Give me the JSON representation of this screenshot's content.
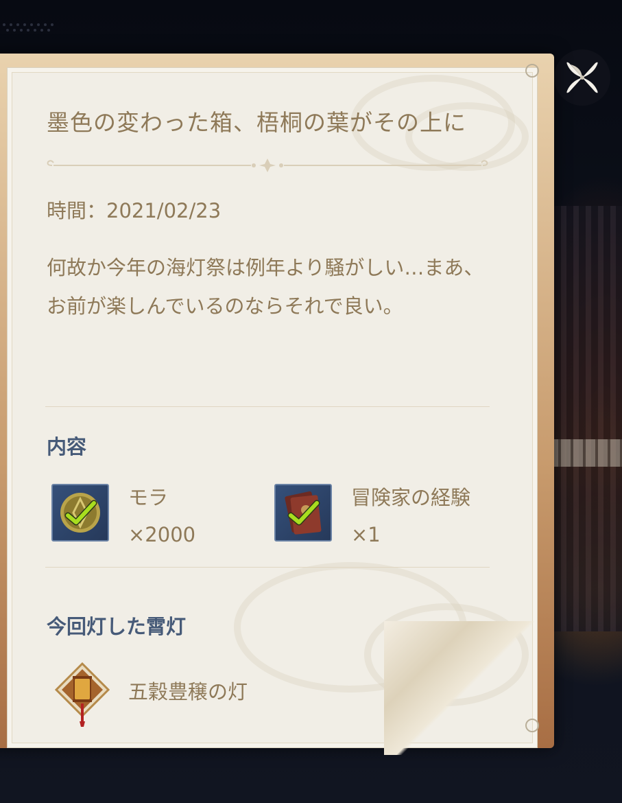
{
  "letter": {
    "title": "墨色の変わった箱、梧桐の葉がその上に",
    "time": "時間：2021/02/23",
    "message": "何故か今年の海灯祭は例年より騒がしい…まあ、お前が楽しんでいるのならそれで良い。"
  },
  "contents": {
    "heading": "内容",
    "items": [
      {
        "name": "モラ",
        "quantity": "×2000",
        "icon": "mora-coin-icon",
        "claimed": true
      },
      {
        "name": "冒険家の経験",
        "quantity": "×1",
        "icon": "adventurers-experience-book-icon",
        "claimed": true
      }
    ]
  },
  "lantern": {
    "heading": "今回灯した霄灯",
    "name": "五穀豊穣の灯",
    "icon": "xiao-lantern-icon"
  },
  "close_button": {
    "icon": "close-icon"
  },
  "colors": {
    "text_brown": "#8e7958",
    "heading_blue": "#465a78",
    "check_green": "#9ed11c",
    "paper": "#f1eee6"
  }
}
